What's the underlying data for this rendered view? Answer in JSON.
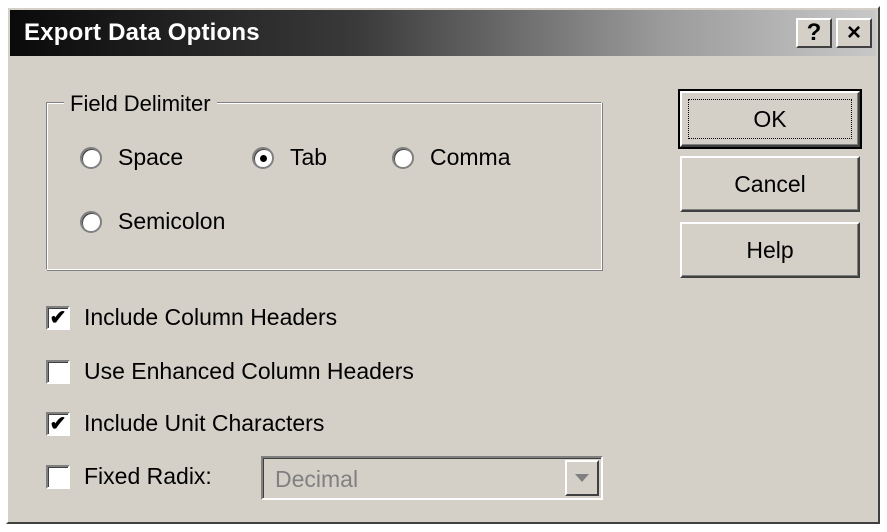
{
  "dialog": {
    "title": "Export Data Options",
    "help_button": "?",
    "close_button": "×"
  },
  "field_delimiter": {
    "legend": "Field Delimiter",
    "options": [
      {
        "label": "Space",
        "selected": false
      },
      {
        "label": "Tab",
        "selected": true
      },
      {
        "label": "Comma",
        "selected": false
      },
      {
        "label": "Semicolon",
        "selected": false
      }
    ]
  },
  "checkboxes": {
    "include_column_headers": {
      "label": "Include Column Headers",
      "checked": true
    },
    "use_enhanced_column_headers": {
      "label": "Use Enhanced Column Headers",
      "checked": false
    },
    "include_unit_characters": {
      "label": "Include Unit Characters",
      "checked": true
    },
    "fixed_radix": {
      "label": "Fixed Radix:",
      "checked": false
    }
  },
  "radix_select": {
    "value": "Decimal",
    "enabled": false
  },
  "buttons": {
    "ok": "OK",
    "cancel": "Cancel",
    "help": "Help"
  },
  "check_mark": "✔",
  "colors": {
    "face": "#d4d0c8",
    "title_start": "#0a0a0a",
    "title_end": "#c8c8c8",
    "disabled_text": "#808080"
  }
}
